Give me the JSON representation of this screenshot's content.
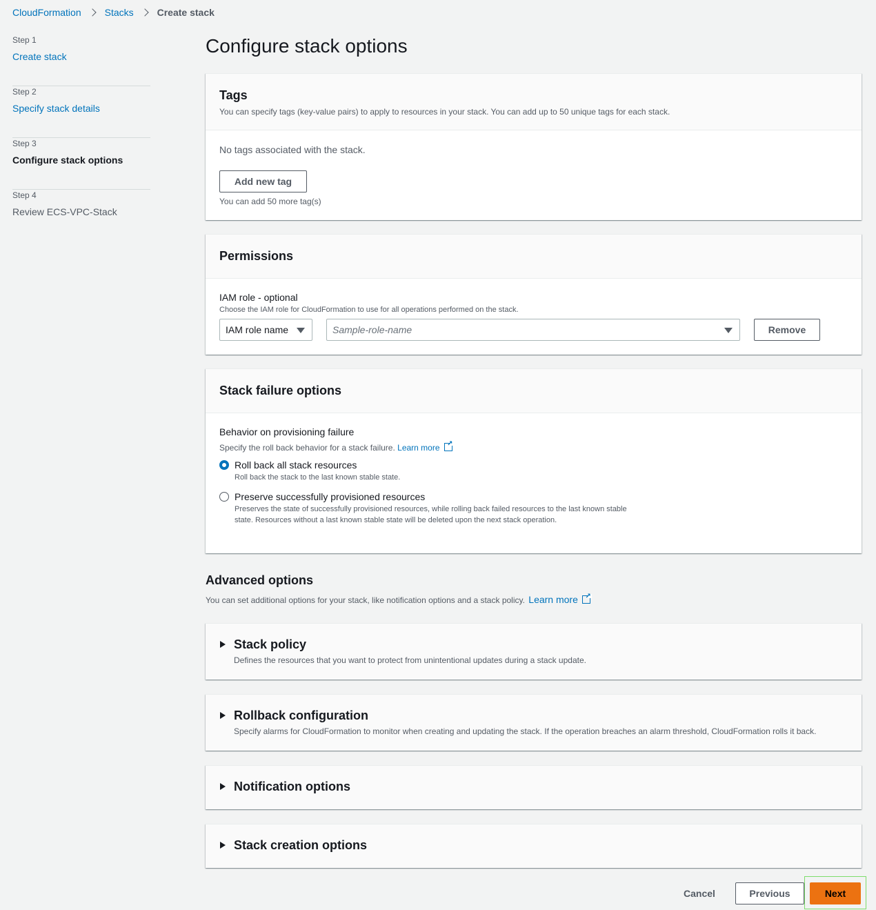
{
  "breadcrumb": {
    "items": [
      "CloudFormation",
      "Stacks"
    ],
    "current": "Create stack"
  },
  "steps": [
    {
      "num": "Step 1",
      "label": "Create stack"
    },
    {
      "num": "Step 2",
      "label": "Specify stack details"
    },
    {
      "num": "Step 3",
      "label": "Configure stack options"
    },
    {
      "num": "Step 4",
      "label": "Review ECS-VPC-Stack"
    }
  ],
  "page_title": "Configure stack options",
  "tags": {
    "title": "Tags",
    "description": "You can specify tags (key-value pairs) to apply to resources in your stack. You can add up to 50 unique tags for each stack.",
    "empty": "No tags associated with the stack.",
    "add_button": "Add new tag",
    "remaining": "You can add 50 more tag(s)"
  },
  "permissions": {
    "title": "Permissions",
    "label": "IAM role - optional",
    "description": "Choose the IAM role for CloudFormation to use for all operations performed on the stack.",
    "type_select": "IAM role name",
    "role_placeholder": "Sample-role-name",
    "remove_button": "Remove"
  },
  "failure": {
    "title": "Stack failure options",
    "label": "Behavior on provisioning failure",
    "description": "Specify the roll back behavior for a stack failure.",
    "learn_more": "Learn more",
    "options": [
      {
        "label": "Roll back all stack resources",
        "desc1": "Roll back the stack to the last known stable state.",
        "desc2": "",
        "checked": true
      },
      {
        "label": "Preserve successfully provisioned resources",
        "desc1": "Preserves the state of successfully provisioned resources, while rolling back failed resources to the last known stable",
        "desc2": "state. Resources without a last known stable state will be deleted upon the next stack operation.",
        "checked": false
      }
    ]
  },
  "advanced": {
    "title": "Advanced options",
    "description": "You can set additional options for your stack, like notification options and a stack policy.",
    "learn_more": "Learn more",
    "sections": [
      {
        "title": "Stack policy",
        "desc": "Defines the resources that you want to protect from unintentional updates during a stack update."
      },
      {
        "title": "Rollback configuration",
        "desc": "Specify alarms for CloudFormation to monitor when creating and updating the stack. If the operation breaches an alarm threshold, CloudFormation rolls it back."
      },
      {
        "title": "Notification options",
        "desc": ""
      },
      {
        "title": "Stack creation options",
        "desc": ""
      }
    ]
  },
  "footer": {
    "cancel": "Cancel",
    "previous": "Previous",
    "next": "Next"
  },
  "colors": {
    "link": "#0073bb",
    "primary_button": "#ec7211",
    "background": "#f2f3f3",
    "highlight": "#7ddd6b"
  }
}
